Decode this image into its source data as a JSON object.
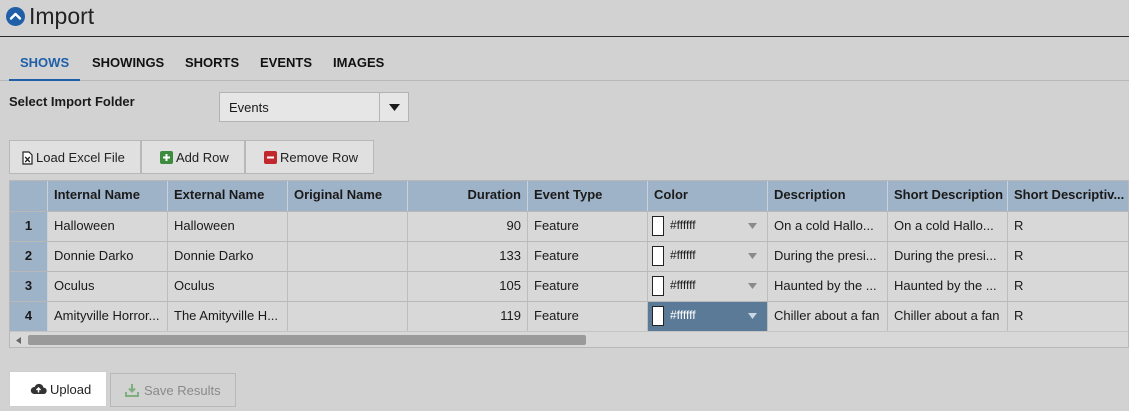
{
  "header": {
    "title": "Import",
    "icon": "chevron-up-circle-icon"
  },
  "tabs": [
    {
      "label": "SHOWS",
      "active": true
    },
    {
      "label": "SHOWINGS",
      "active": false
    },
    {
      "label": "SHORTS",
      "active": false
    },
    {
      "label": "EVENTS",
      "active": false
    },
    {
      "label": "IMAGES",
      "active": false
    }
  ],
  "folder": {
    "label": "Select Import Folder",
    "value": "Events"
  },
  "toolbar": {
    "load_label": "Load Excel File",
    "add_label": "Add Row",
    "remove_label": "Remove Row"
  },
  "grid": {
    "columns": [
      "Internal Name",
      "External Name",
      "Original Name",
      "Duration",
      "Event Type",
      "Color",
      "Description",
      "Short Description",
      "Short Descriptiv..."
    ],
    "rows": [
      {
        "num": "1",
        "internal": "Halloween",
        "external": "Halloween",
        "original": "",
        "duration": "90",
        "event_type": "Feature",
        "color": "#ffffff",
        "description": "On a cold Hallo...",
        "short_description": "On a cold Hallo...",
        "short_descriptive": "R"
      },
      {
        "num": "2",
        "internal": "Donnie Darko",
        "external": "Donnie Darko",
        "original": "",
        "duration": "133",
        "event_type": "Feature",
        "color": "#ffffff",
        "description": "During the presi...",
        "short_description": "During the presi...",
        "short_descriptive": "R"
      },
      {
        "num": "3",
        "internal": "Oculus",
        "external": "Oculus",
        "original": "",
        "duration": "105",
        "event_type": "Feature",
        "color": "#ffffff",
        "description": "Haunted by the ...",
        "short_description": "Haunted by the ...",
        "short_descriptive": "R"
      },
      {
        "num": "4",
        "internal": "Amityville Horror...",
        "external": "The Amityville H...",
        "original": "",
        "duration": "119",
        "event_type": "Feature",
        "color": "#ffffff",
        "description": "Chiller about a fan",
        "short_description": "Chiller about a fan",
        "short_descriptive": "R"
      }
    ]
  },
  "actions": {
    "upload_label": "Upload",
    "save_label": "Save Results"
  },
  "colors": {
    "accent": "#1e5fa8",
    "grid_header": "#9fb3c8",
    "selected_cell": "#5a7a98"
  }
}
